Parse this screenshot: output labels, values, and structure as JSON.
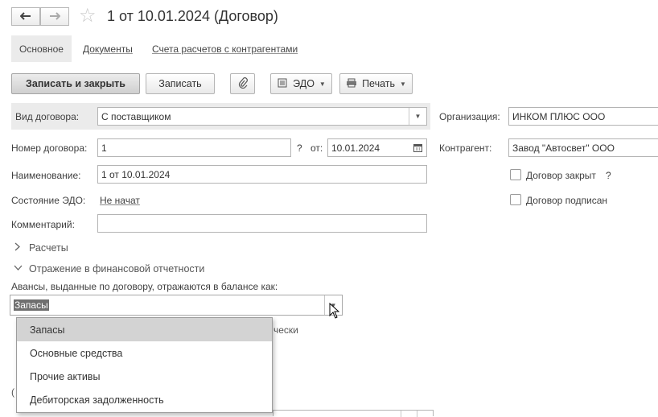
{
  "window": {
    "title": "1 от 10.01.2024 (Договор)"
  },
  "nav": {
    "back_glyph": "🡐",
    "forward_glyph": "🡒",
    "star_glyph": "☆"
  },
  "tabs": [
    {
      "label": "Основное",
      "active": true
    },
    {
      "label": "Документы",
      "active": false
    },
    {
      "label": "Счета расчетов с контрагентами",
      "active": false
    }
  ],
  "toolbar": {
    "save_close_label": "Записать и закрыть",
    "save_label": "Записать",
    "attach_icon": "paperclip-icon",
    "edo_label": "ЭДО",
    "print_label": "Печать"
  },
  "form": {
    "contract_type": {
      "label": "Вид договора:",
      "value": "С поставщиком"
    },
    "contract_number": {
      "label": "Номер договора:",
      "value": "1",
      "help": "?"
    },
    "from": {
      "label": "от:",
      "value": "10.01.2024"
    },
    "name": {
      "label": "Наименование:",
      "value": "1 от 10.01.2024"
    },
    "edo_state": {
      "label": "Состояние ЭДО:",
      "value": "Не начат"
    },
    "comment": {
      "label": "Комментарий:",
      "value": ""
    },
    "organization": {
      "label": "Организация:",
      "value": "ИНКОМ ПЛЮС ООО"
    },
    "counterparty": {
      "label": "Контрагент:",
      "value": "Завод \"Автосвет\" ООО"
    },
    "contract_closed": {
      "label": "Договор закрыт",
      "help": "?",
      "checked": false
    },
    "contract_signed": {
      "label": "Договор подписан",
      "checked": false
    }
  },
  "sections": {
    "calculations": {
      "label": "Расчеты",
      "expanded": false
    },
    "financial_reporting": {
      "label": "Отражение в финансовой отчетности",
      "expanded": true
    }
  },
  "advances": {
    "label": "Авансы, выданные по договору, отражаются в балансе как:",
    "value": "Запасы",
    "behind_text": "чески",
    "behind_letter": "("
  },
  "dropdown": {
    "options": [
      "Запасы",
      "Основные средства",
      "Прочие активы",
      "Дебиторская задолженность"
    ],
    "selected_index": 0
  }
}
